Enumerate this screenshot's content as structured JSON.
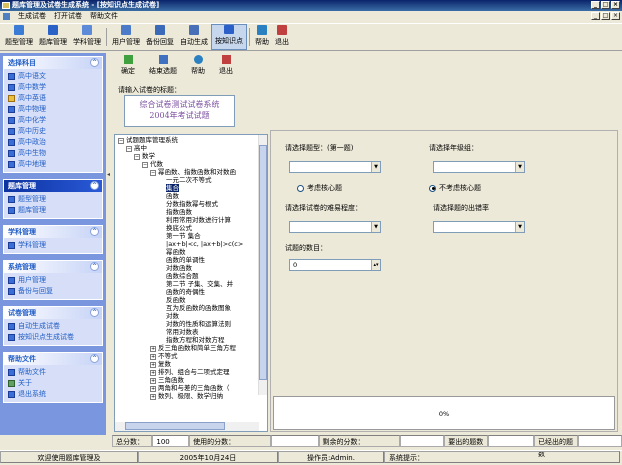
{
  "window": {
    "title": "题库管理及试卷生成系统 - [按知识点生成试卷]"
  },
  "menu": [
    "生成试卷",
    "打开试卷",
    "帮助文件"
  ],
  "toolbar": [
    {
      "label": "题型管理",
      "color": "#3a7bd5"
    },
    {
      "label": "题库管理",
      "color": "#2b62c8"
    },
    {
      "label": "学科管理",
      "color": "#5a8ad8"
    },
    {
      "label": "用户管理",
      "color": "#4a7ac8"
    },
    {
      "label": "备份回复",
      "color": "#3a6ab8"
    },
    {
      "label": "自动生成",
      "color": "#4870b8"
    },
    {
      "label": "按知识点",
      "color": "#2a60c8"
    },
    {
      "label": "帮助",
      "color": "#2a80c0"
    },
    {
      "label": "退出",
      "color": "#c04040"
    }
  ],
  "sidebar": {
    "subject": {
      "title": "选择科目",
      "items": [
        "高中语文",
        "高中数学",
        "高中英语",
        "高中物理",
        "高中化学",
        "高中历史",
        "高中政治",
        "高中生物",
        "高中地理"
      ]
    },
    "bank": {
      "title": "题库管理",
      "items": [
        "题型管理",
        "题库管理"
      ]
    },
    "course": {
      "title": "学科管理",
      "items": [
        "学科管理"
      ]
    },
    "system": {
      "title": "系统管理",
      "items": [
        "用户管理",
        "备份与回复"
      ]
    },
    "paper": {
      "title": "试卷管理",
      "items": [
        "自动生成试卷",
        "按知识点生成试卷"
      ]
    },
    "help": {
      "title": "帮助文件",
      "items": [
        "帮助文件",
        "关于",
        "退出系统"
      ]
    }
  },
  "subtoolbar": [
    "确定",
    "结束选题",
    "帮助",
    "退出"
  ],
  "form": {
    "title_label": "请输入试卷的标题：",
    "title_line1": "综合试卷测试试卷系统",
    "title_line2": "2004年考试试题",
    "qtype_label": "请选择题型：(第一题)",
    "grade_label": "请选择年级组：",
    "radio1": "考虑核心题",
    "radio2": "不考虑核心题",
    "difficulty_label": "请选择试卷的难易程度：",
    "frequency_label": "请选择题的出错率",
    "count_label": "试题的数目：",
    "count_value": "0",
    "progress": "0%"
  },
  "tree": [
    {
      "t": "试题题库管理系统",
      "d": 0,
      "b": "−"
    },
    {
      "t": "高中",
      "d": 1,
      "b": "−"
    },
    {
      "t": "数学",
      "d": 2,
      "b": "−"
    },
    {
      "t": "代数",
      "d": 3,
      "b": "−"
    },
    {
      "t": "幂函数、指数函数和对数函",
      "d": 4,
      "b": "−"
    },
    {
      "t": "一元二次不等式",
      "d": 5,
      "b": ""
    },
    {
      "t": "集合",
      "d": 5,
      "b": "",
      "sel": true
    },
    {
      "t": "函数",
      "d": 5,
      "b": ""
    },
    {
      "t": "分数指数幂与根式",
      "d": 5,
      "b": ""
    },
    {
      "t": "指数函数",
      "d": 5,
      "b": ""
    },
    {
      "t": "利用常用对数进行计算",
      "d": 5,
      "b": ""
    },
    {
      "t": "换底公式",
      "d": 5,
      "b": ""
    },
    {
      "t": "第一节  集合",
      "d": 5,
      "b": ""
    },
    {
      "t": "|ax+b|<c, |ax+b|>c(c>",
      "d": 5,
      "b": ""
    },
    {
      "t": "幂函数",
      "d": 5,
      "b": ""
    },
    {
      "t": "函数的单调性",
      "d": 5,
      "b": ""
    },
    {
      "t": "对数函数",
      "d": 5,
      "b": ""
    },
    {
      "t": "函数综合题",
      "d": 5,
      "b": ""
    },
    {
      "t": "第二节  子集、交集、并",
      "d": 5,
      "b": ""
    },
    {
      "t": "函数的奇偶性",
      "d": 5,
      "b": ""
    },
    {
      "t": "反函数",
      "d": 5,
      "b": ""
    },
    {
      "t": "互为反函数的函数图象",
      "d": 5,
      "b": ""
    },
    {
      "t": "对数",
      "d": 5,
      "b": ""
    },
    {
      "t": "对数的性质和运算法则",
      "d": 5,
      "b": ""
    },
    {
      "t": "常用对数表",
      "d": 5,
      "b": ""
    },
    {
      "t": "指数方程和对数方程",
      "d": 5,
      "b": ""
    },
    {
      "t": "反三角函数和简单三角方程",
      "d": 4,
      "b": "+"
    },
    {
      "t": "不等式",
      "d": 4,
      "b": "+"
    },
    {
      "t": "复数",
      "d": 4,
      "b": "+"
    },
    {
      "t": "排列、组合与二项式定理",
      "d": 4,
      "b": "+"
    },
    {
      "t": "三角函数",
      "d": 4,
      "b": "+"
    },
    {
      "t": "两角和与差的三角函数（",
      "d": 4,
      "b": "+"
    },
    {
      "t": "数列、极限、数学归纳",
      "d": 4,
      "b": "+"
    }
  ],
  "stats": [
    {
      "label": "总分数：",
      "value": "100"
    },
    {
      "label": "使用的分数：",
      "value": ""
    },
    {
      "label": "剩余的分数：",
      "value": ""
    },
    {
      "label": "要出的题数",
      "value": ""
    },
    {
      "label": "已经出的题数",
      "value": ""
    }
  ],
  "status": {
    "welcome": "欢迎使用题库管理及",
    "date": "2005年10月24日",
    "operator": "操作员:Admin.",
    "hint": "系统提示："
  }
}
